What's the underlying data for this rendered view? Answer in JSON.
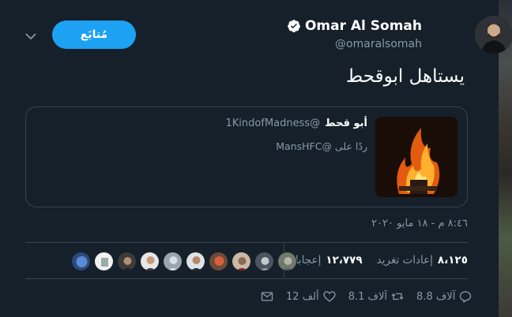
{
  "author": {
    "name": "Omar Al Somah",
    "handle": "@omaralsomah"
  },
  "follow_button_label": "مُتابَع",
  "tweet": {
    "text": "يستاهل ابوقحط"
  },
  "quoted": {
    "name": "أبو قحط",
    "handle": "@1KindofMadness",
    "reply_to": "ردًا على @MansHFC"
  },
  "timestamp": "٨:٤٦ م - ١٨ مايو ٢٠٢٠",
  "stats": {
    "retweets_count": "٨،١٢٥",
    "retweets_label": "إعادات تغريد",
    "likes_count": "١٢،٧٧٩",
    "likes_label": "إعجابات"
  },
  "actions": {
    "reply_count": "8.8 آلاف",
    "retweet_count": "8.1 آلاف",
    "like_count": "12 ألف"
  },
  "colors": {
    "background": "#15202b",
    "accent": "#1da1f2",
    "secondary_text": "#8899a6",
    "border": "#38444d"
  }
}
